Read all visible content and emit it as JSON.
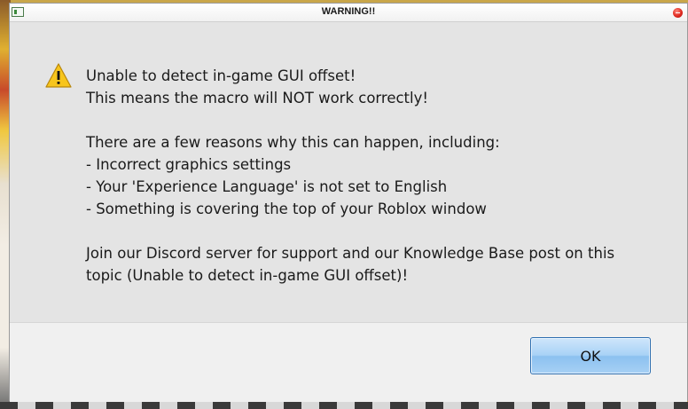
{
  "window": {
    "title": "WARNING!!",
    "close_label": "Close"
  },
  "icons": {
    "app": "app-icon",
    "warning": "warning-icon",
    "close": "close-icon"
  },
  "message": {
    "lines": [
      "Unable to detect in-game GUI offset!",
      "This means the macro will NOT work correctly!",
      "",
      "There are a few reasons why this can happen, including:",
      "- Incorrect graphics settings",
      "- Your 'Experience Language' is not set to English",
      "- Something is covering the top of your Roblox window",
      "",
      "Join our Discord server for support and our Knowledge Base post on this",
      "topic (Unable to detect in-game GUI offset)!"
    ]
  },
  "buttons": {
    "ok_label": "OK"
  },
  "colors": {
    "dialog_bg": "#e4e4e4",
    "footer_bg": "#f0f0f0",
    "ok_button_bg": "#a9d2f6",
    "warning_yellow": "#f7c51c"
  }
}
